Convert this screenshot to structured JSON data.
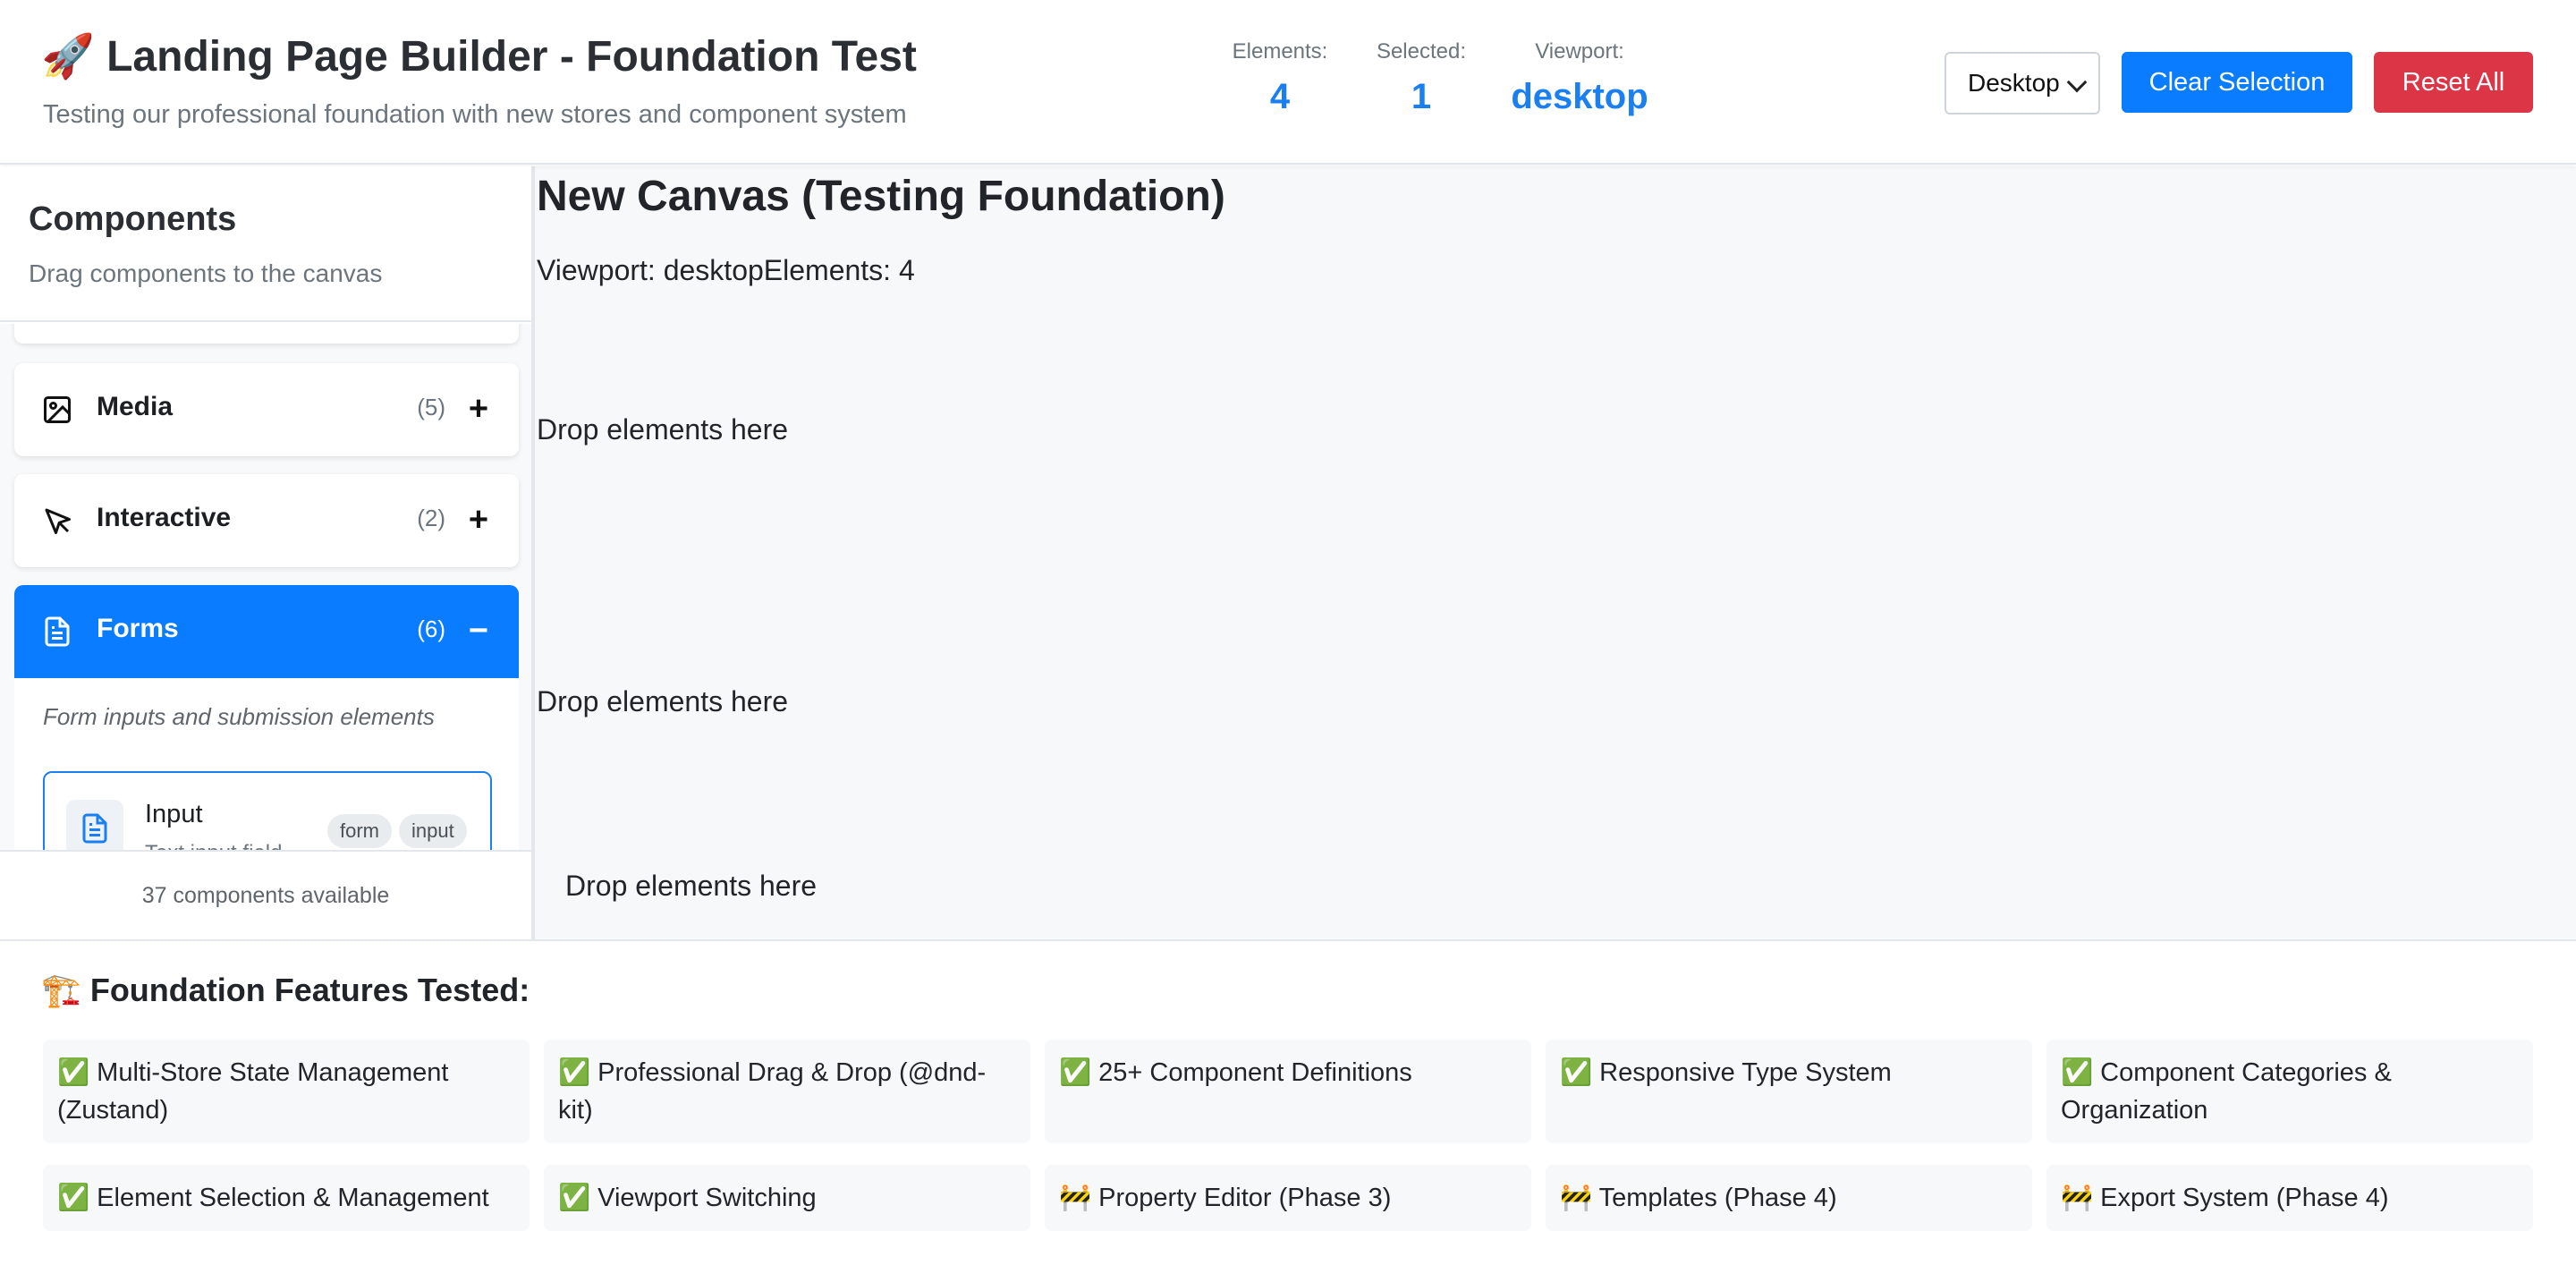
{
  "header": {
    "title": "🚀 Landing Page Builder - Foundation Test",
    "subtitle": "Testing our professional foundation with new stores and component system",
    "stats": [
      {
        "label": "Elements:",
        "value": "4"
      },
      {
        "label": "Selected:",
        "value": "1"
      },
      {
        "label": "Viewport:",
        "value": "desktop"
      }
    ],
    "viewport_select": "Desktop",
    "clear_label": "Clear Selection",
    "reset_label": "Reset All"
  },
  "sidebar": {
    "title": "Components",
    "subtitle": "Drag components to the canvas",
    "categories": [
      {
        "name": "Media",
        "count": "(5)",
        "toggle": "+",
        "icon": "image-icon"
      },
      {
        "name": "Interactive",
        "count": "(2)",
        "toggle": "+",
        "icon": "cursor-icon"
      },
      {
        "name": "Forms",
        "count": "(6)",
        "toggle": "−",
        "icon": "document-icon"
      }
    ],
    "forms_description": "Form inputs and submission elements",
    "component": {
      "name": "Input",
      "description": "Text input field",
      "tags": [
        "form",
        "input"
      ],
      "icon": "document-icon"
    },
    "footer": "37 components available"
  },
  "canvas": {
    "title": "New Canvas (Testing Foundation)",
    "info": "Viewport: desktopElements: 4",
    "drop_zones": [
      "Drop elements here",
      "Drop elements here",
      "Drop elements here"
    ]
  },
  "features": {
    "title": "🏗️ Foundation Features Tested:",
    "items": [
      "✅ Multi-Store State Management (Zustand)",
      "✅ Professional Drag & Drop (@dnd-kit)",
      "✅ 25+ Component Definitions",
      "✅ Responsive Type System",
      "✅ Component Categories & Organization",
      "✅ Element Selection & Management",
      "✅ Viewport Switching",
      "🚧 Property Editor (Phase 3)",
      "🚧 Templates (Phase 4)",
      "🚧 Export System (Phase 4)"
    ]
  },
  "colors": {
    "accent": "#0a7cff",
    "danger": "#dc3545",
    "stat_value": "#1a7ff0"
  }
}
